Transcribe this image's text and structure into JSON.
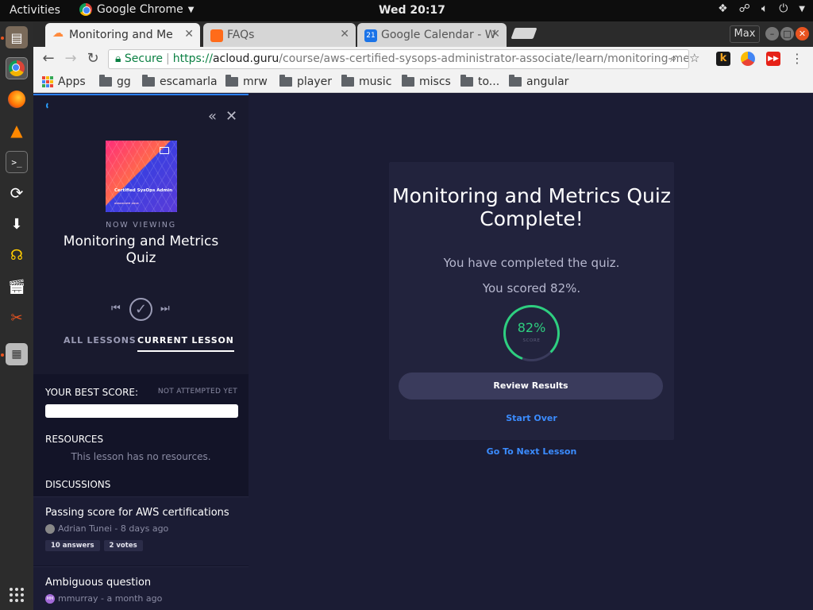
{
  "topbar": {
    "activities": "Activities",
    "app_name": "Google Chrome",
    "clock": "Wed 20:17"
  },
  "browser": {
    "tabs": [
      {
        "title": "Monitoring and Me",
        "favicon": "cloud-guru-icon"
      },
      {
        "title": "FAQs",
        "favicon": "cube-icon"
      },
      {
        "title": "Google Calendar - W",
        "favicon": "calendar-icon",
        "badge": "21"
      }
    ],
    "window_user": "Max",
    "secure_label": "Secure",
    "url_scheme": "https://",
    "url_host": "acloud.guru",
    "url_path": "/course/aws-certified-sysops-administrator-associate/learn/monitoring-met...",
    "bookmarks": [
      "Apps",
      "gg",
      "escamarla",
      "mrw",
      "player",
      "music",
      "miscs",
      "to...",
      "angular"
    ]
  },
  "sidebar": {
    "now_viewing": "NOW VIEWING",
    "lesson_title": "Monitoring and Metrics Quiz",
    "thumbnail_text": "Certified SysOps Admin",
    "thumbnail_subtext": "ASSOCIATE 2018",
    "tabs": {
      "all": "ALL LESSONS",
      "current": "CURRENT LESSON"
    },
    "best_score_label": "YOUR BEST SCORE:",
    "best_score_value": "NOT ATTEMPTED YET",
    "resources_label": "RESOURCES",
    "no_resources": "This lesson has no resources.",
    "discussions_label": "DISCUSSIONS",
    "discussions": [
      {
        "title": "Passing score for AWS certifications",
        "meta": "Adrian Tunei - 8 days ago",
        "answers": "10 answers",
        "votes": "2 votes"
      },
      {
        "title": "Ambiguous question",
        "meta": "mmurray - a month ago",
        "avatar_text": "MM"
      }
    ]
  },
  "quiz": {
    "heading": "Monitoring and Metrics Quiz Complete!",
    "completed_text": "You have completed the quiz.",
    "scored_text": "You scored 82%.",
    "score_value": "82%",
    "score_fraction": 0.82,
    "score_label": "SCORE",
    "review_button": "Review Results",
    "start_over": "Start Over",
    "next_lesson": "Go To Next Lesson"
  },
  "colors": {
    "page_bg": "#1b1c34",
    "sidebar_bg": "#191a2e",
    "accent_green": "#2ecf80",
    "link_blue": "#3b8cff",
    "ubuntu_orange": "#e95420"
  }
}
